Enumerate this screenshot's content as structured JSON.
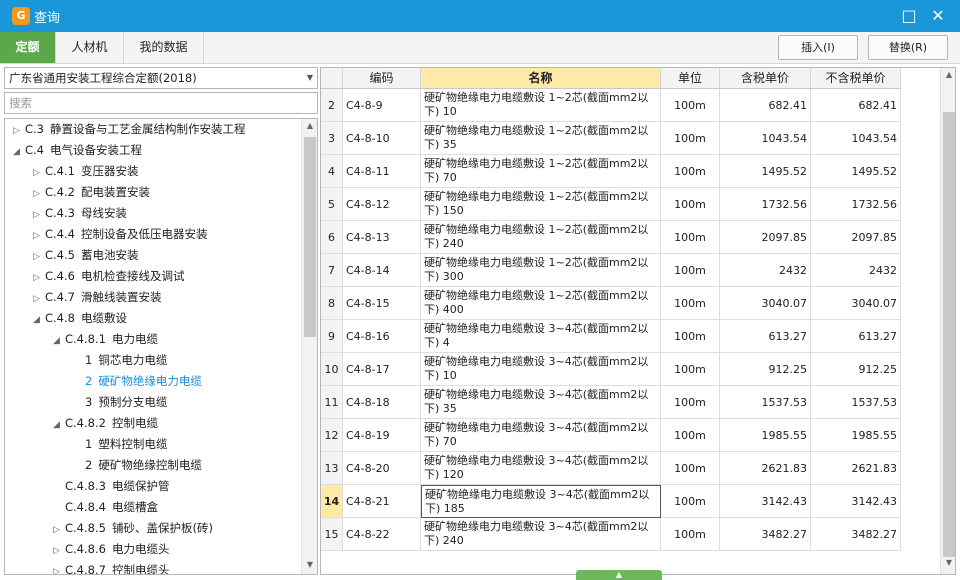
{
  "window": {
    "title": "查询",
    "app_icon_glyph": "G"
  },
  "window_controls": {
    "maximize_glyph": "□",
    "close_glyph": "✕"
  },
  "tabs": [
    {
      "label": "定额",
      "active": true
    },
    {
      "label": "人材机",
      "active": false
    },
    {
      "label": "我的数据",
      "active": false
    }
  ],
  "actions": {
    "insert_label": "插入(I)",
    "replace_label": "替换(R)"
  },
  "left": {
    "library_select": "广东省通用安装工程综合定额(2018)",
    "search_placeholder": "搜索"
  },
  "tree": [
    {
      "toggle": "▷",
      "number": "C.3",
      "label": "静置设备与工艺金属结构制作安装工程",
      "level": 0,
      "selected": false
    },
    {
      "toggle": "◢",
      "number": "C.4",
      "label": "电气设备安装工程",
      "level": 0,
      "selected": false
    },
    {
      "toggle": "▷",
      "number": "C.4.1",
      "label": "变压器安装",
      "level": 1,
      "selected": false
    },
    {
      "toggle": "▷",
      "number": "C.4.2",
      "label": "配电装置安装",
      "level": 1,
      "selected": false
    },
    {
      "toggle": "▷",
      "number": "C.4.3",
      "label": "母线安装",
      "level": 1,
      "selected": false
    },
    {
      "toggle": "▷",
      "number": "C.4.4",
      "label": "控制设备及低压电器安装",
      "level": 1,
      "selected": false
    },
    {
      "toggle": "▷",
      "number": "C.4.5",
      "label": "蓄电池安装",
      "level": 1,
      "selected": false
    },
    {
      "toggle": "▷",
      "number": "C.4.6",
      "label": "电机检查接线及调试",
      "level": 1,
      "selected": false
    },
    {
      "toggle": "▷",
      "number": "C.4.7",
      "label": "滑触线装置安装",
      "level": 1,
      "selected": false
    },
    {
      "toggle": "◢",
      "number": "C.4.8",
      "label": "电缆敷设",
      "level": 1,
      "selected": false
    },
    {
      "toggle": "◢",
      "number": "C.4.8.1",
      "label": "电力电缆",
      "level": 2,
      "selected": false
    },
    {
      "toggle": "",
      "number": "1",
      "label": "铜芯电力电缆",
      "level": 3,
      "selected": false
    },
    {
      "toggle": "",
      "number": "2",
      "label": "硬矿物绝缘电力电缆",
      "level": 3,
      "selected": true
    },
    {
      "toggle": "",
      "number": "3",
      "label": "预制分支电缆",
      "level": 3,
      "selected": false
    },
    {
      "toggle": "◢",
      "number": "C.4.8.2",
      "label": "控制电缆",
      "level": 2,
      "selected": false
    },
    {
      "toggle": "",
      "number": "1",
      "label": "塑料控制电缆",
      "level": 3,
      "selected": false
    },
    {
      "toggle": "",
      "number": "2",
      "label": "硬矿物绝缘控制电缆",
      "level": 3,
      "selected": false
    },
    {
      "toggle": "",
      "number": "C.4.8.3",
      "label": "电缆保护管",
      "level": 2,
      "selected": false
    },
    {
      "toggle": "",
      "number": "C.4.8.4",
      "label": "电缆槽盒",
      "level": 2,
      "selected": false
    },
    {
      "toggle": "▷",
      "number": "C.4.8.5",
      "label": "铺砂、盖保护板(砖)",
      "level": 2,
      "selected": false
    },
    {
      "toggle": "▷",
      "number": "C.4.8.6",
      "label": "电力电缆头",
      "level": 2,
      "selected": false
    },
    {
      "toggle": "▷",
      "number": "C.4.8.7",
      "label": "控制电缆头",
      "level": 2,
      "selected": false
    }
  ],
  "grid": {
    "columns": [
      "",
      "编码",
      "名称",
      "单位",
      "含税单价",
      "不含税单价"
    ],
    "rows": [
      {
        "n": "2",
        "code": "C4-8-9",
        "name": "硬矿物绝缘电力电缆敷设 1~2芯(截面mm2以下) 10",
        "unit": "100m",
        "tax": "682.41",
        "notax": "682.41"
      },
      {
        "n": "3",
        "code": "C4-8-10",
        "name": "硬矿物绝缘电力电缆敷设 1~2芯(截面mm2以下) 35",
        "unit": "100m",
        "tax": "1043.54",
        "notax": "1043.54"
      },
      {
        "n": "4",
        "code": "C4-8-11",
        "name": "硬矿物绝缘电力电缆敷设 1~2芯(截面mm2以下) 70",
        "unit": "100m",
        "tax": "1495.52",
        "notax": "1495.52"
      },
      {
        "n": "5",
        "code": "C4-8-12",
        "name": "硬矿物绝缘电力电缆敷设 1~2芯(截面mm2以下) 150",
        "unit": "100m",
        "tax": "1732.56",
        "notax": "1732.56"
      },
      {
        "n": "6",
        "code": "C4-8-13",
        "name": "硬矿物绝缘电力电缆敷设 1~2芯(截面mm2以下) 240",
        "unit": "100m",
        "tax": "2097.85",
        "notax": "2097.85"
      },
      {
        "n": "7",
        "code": "C4-8-14",
        "name": "硬矿物绝缘电力电缆敷设 1~2芯(截面mm2以下) 300",
        "unit": "100m",
        "tax": "2432",
        "notax": "2432"
      },
      {
        "n": "8",
        "code": "C4-8-15",
        "name": "硬矿物绝缘电力电缆敷设 1~2芯(截面mm2以下) 400",
        "unit": "100m",
        "tax": "3040.07",
        "notax": "3040.07"
      },
      {
        "n": "9",
        "code": "C4-8-16",
        "name": "硬矿物绝缘电力电缆敷设 3~4芯(截面mm2以下) 4",
        "unit": "100m",
        "tax": "613.27",
        "notax": "613.27"
      },
      {
        "n": "10",
        "code": "C4-8-17",
        "name": "硬矿物绝缘电力电缆敷设 3~4芯(截面mm2以下) 10",
        "unit": "100m",
        "tax": "912.25",
        "notax": "912.25"
      },
      {
        "n": "11",
        "code": "C4-8-18",
        "name": "硬矿物绝缘电力电缆敷设 3~4芯(截面mm2以下) 35",
        "unit": "100m",
        "tax": "1537.53",
        "notax": "1537.53"
      },
      {
        "n": "12",
        "code": "C4-8-19",
        "name": "硬矿物绝缘电力电缆敷设 3~4芯(截面mm2以下) 70",
        "unit": "100m",
        "tax": "1985.55",
        "notax": "1985.55"
      },
      {
        "n": "13",
        "code": "C4-8-20",
        "name": "硬矿物绝缘电力电缆敷设 3~4芯(截面mm2以下) 120",
        "unit": "100m",
        "tax": "2621.83",
        "notax": "2621.83"
      },
      {
        "n": "14",
        "code": "C4-8-21",
        "name": "硬矿物绝缘电力电缆敷设 3~4芯(截面mm2以下) 185",
        "unit": "100m",
        "tax": "3142.43",
        "notax": "3142.43",
        "current": true
      },
      {
        "n": "15",
        "code": "C4-8-22",
        "name": "硬矿物绝缘电力电缆敷设 3~4芯(截面mm2以下) 240",
        "unit": "100m",
        "tax": "3482.27",
        "notax": "3482.27"
      }
    ]
  },
  "colors": {
    "titlebar": "#1a97d8",
    "active_tab": "#5ba84a",
    "selected_tree": "#1a8fd6",
    "sorted_header": "#fdeaa8"
  }
}
